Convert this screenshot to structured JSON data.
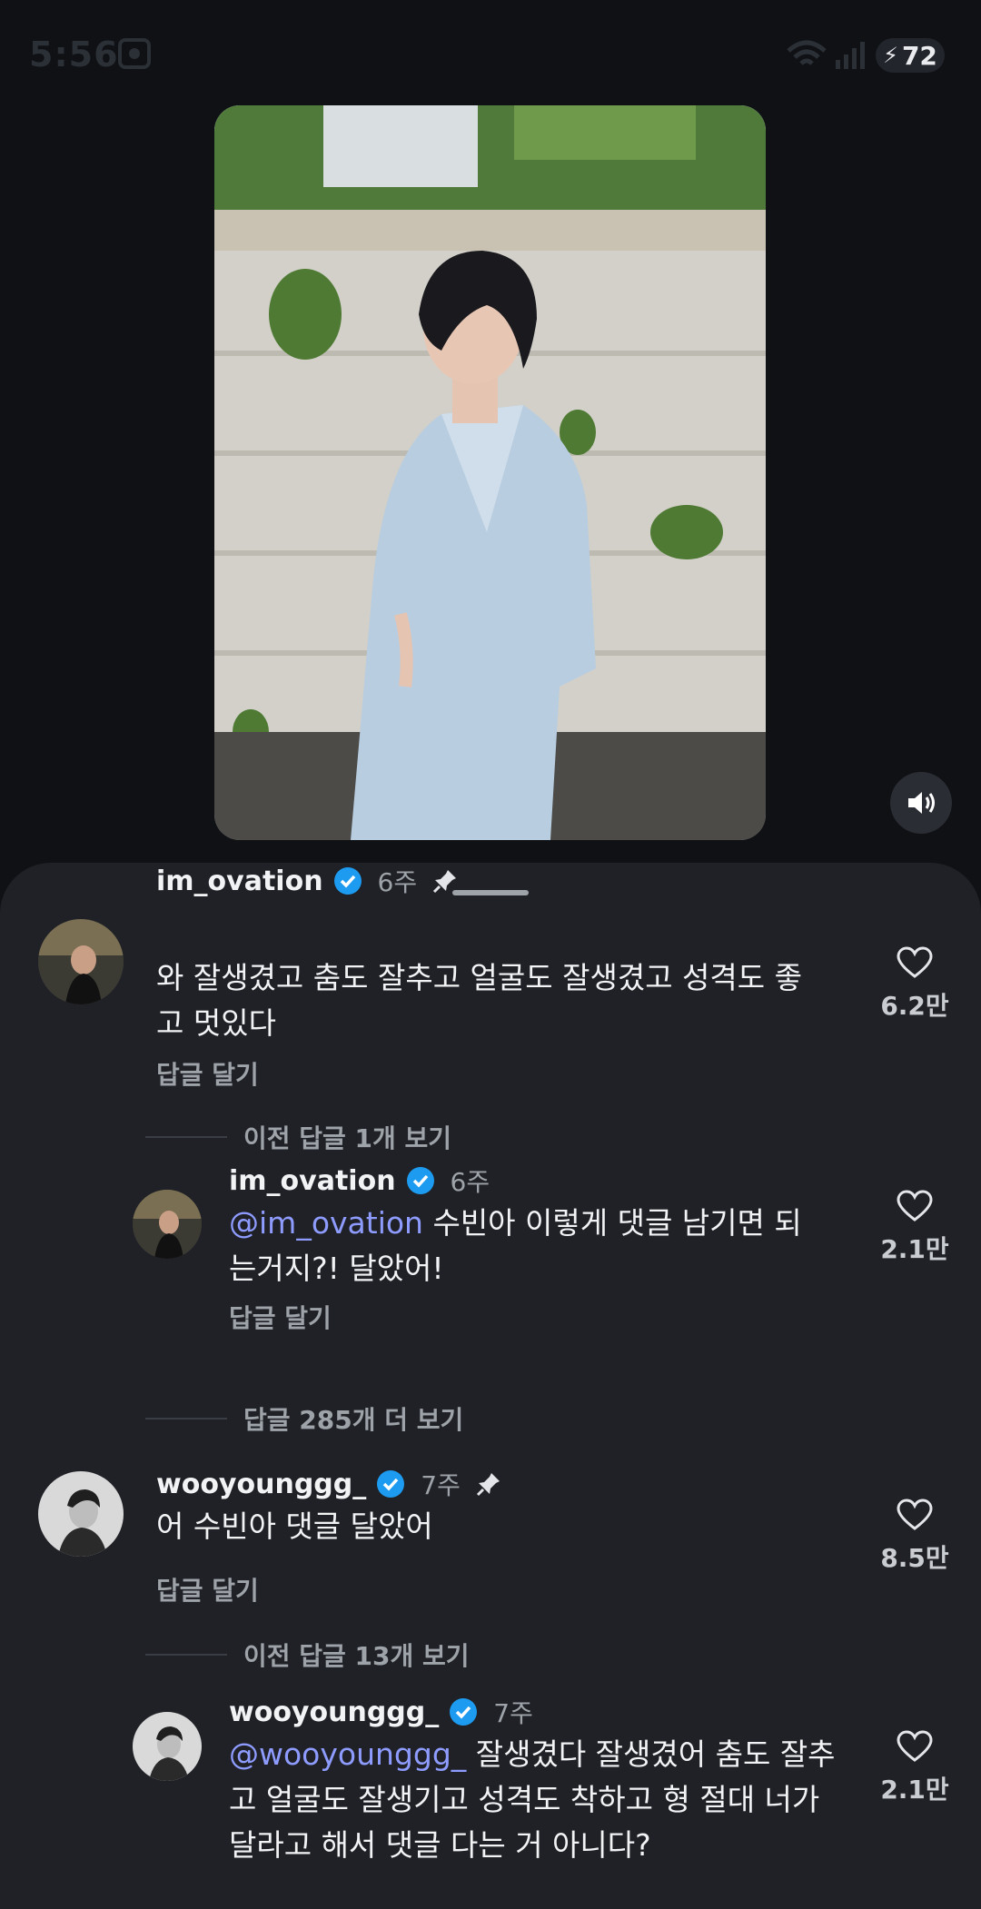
{
  "status_bar": {
    "time": "5:56",
    "battery": "72"
  },
  "comments": [
    {
      "username": "im_ovation",
      "age": "6주",
      "pinned": true,
      "mention": "",
      "text": "와 잘생겼고 춤도 잘추고 얼굴도 잘생겼고 성격도 좋고 멋있다",
      "reply_label": "답글 달기",
      "likes": "6.2만"
    },
    {
      "username": "im_ovation",
      "age": "6주",
      "pinned": false,
      "mention": "@im_ovation",
      "text": " 수빈아  이렇게 댓글 남기면 되는거지?! 달았어!",
      "reply_label": "답글 달기",
      "likes": "2.1만"
    },
    {
      "username": "wooyounggg_",
      "age": "7주",
      "pinned": true,
      "mention": "",
      "text": "어 수빈아 댓글 달았어",
      "reply_label": "답글 달기",
      "likes": "8.5만"
    },
    {
      "username": "wooyounggg_",
      "age": "7주",
      "pinned": false,
      "mention": "@wooyounggg_",
      "text": "  잘생겼다 잘생겼어 춤도 잘추고 얼굴도 잘생기고 성격도 착하고 형 절대 너가 달라고 해서 댓글 다는 거 아니다?",
      "reply_label": "",
      "likes": "2.1만"
    }
  ],
  "thread_links": {
    "prev_replies_1": "이전 답글 1개 보기",
    "more_replies": "답글 285개 더 보기",
    "prev_replies_2": "이전 답글 13개 보기"
  },
  "colors": {
    "background": "#0f1115",
    "sheet": "#1f2126",
    "verified": "#1d9bf0",
    "mention": "#8e9bff"
  }
}
